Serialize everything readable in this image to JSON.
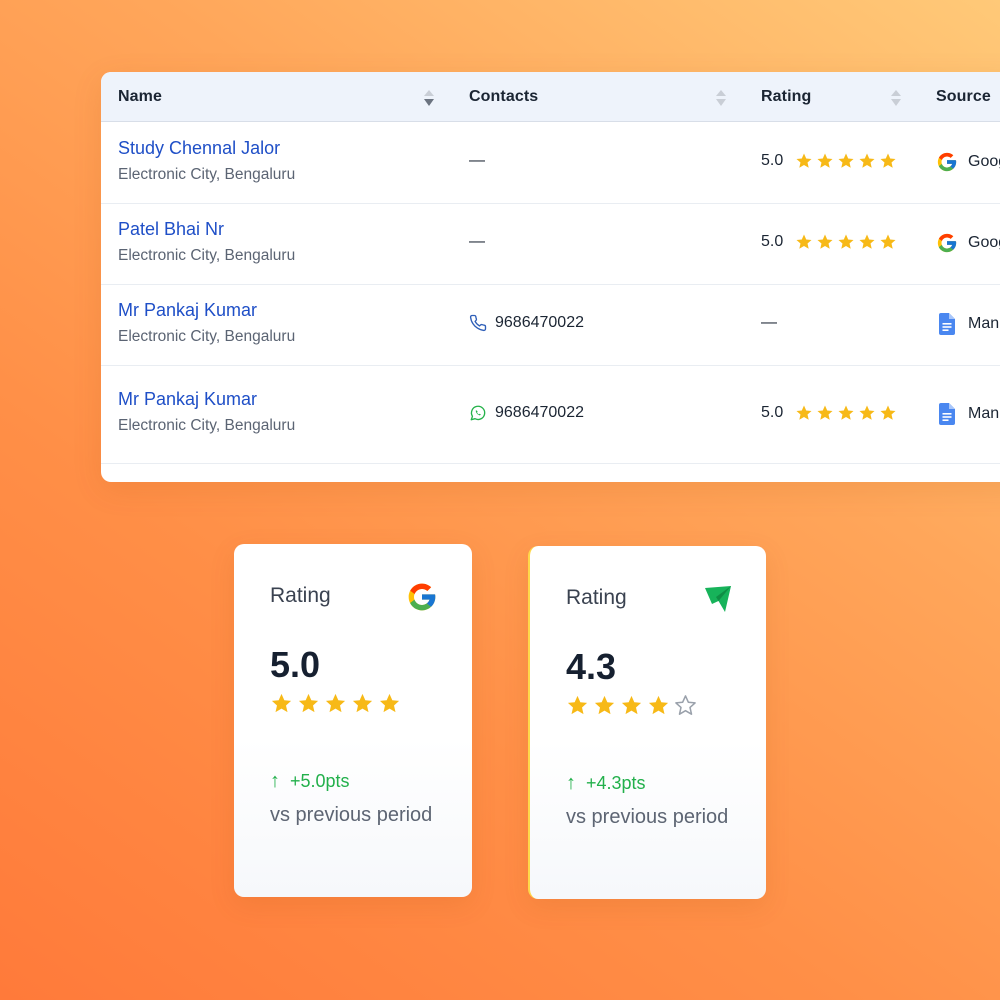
{
  "table": {
    "columns": [
      {
        "key": "name",
        "label": "Name"
      },
      {
        "key": "contacts",
        "label": "Contacts"
      },
      {
        "key": "rating",
        "label": "Rating"
      },
      {
        "key": "source",
        "label": "Source"
      }
    ],
    "rows": [
      {
        "name": "Study Chennal Jalor",
        "location": "Electronic City, Bengaluru",
        "contact": "—",
        "contact_icon": "",
        "rating": "5.0",
        "stars": 5,
        "source": "Goog",
        "source_icon": "google-icon"
      },
      {
        "name": "Patel Bhai Nr",
        "location": "Electronic City, Bengaluru",
        "contact": "—",
        "contact_icon": "",
        "rating": "5.0",
        "stars": 5,
        "source": "Goog",
        "source_icon": "google-icon"
      },
      {
        "name": "Mr Pankaj Kumar",
        "location": "Electronic City, Bengaluru",
        "contact": "9686470022",
        "contact_icon": "phone-icon",
        "rating": "—",
        "stars": 0,
        "source": "Man",
        "source_icon": "document-icon"
      },
      {
        "name": "Mr Pankaj Kumar",
        "location": "Electronic City, Bengaluru",
        "contact": "9686470022",
        "contact_icon": "whatsapp-icon",
        "rating": "5.0",
        "stars": 5,
        "source": "Man",
        "source_icon": "document-icon"
      }
    ]
  },
  "cards": [
    {
      "label": "Rating",
      "logo": "google-icon",
      "value": "5.0",
      "stars": 5,
      "change": "+5.0pts",
      "compare": "vs previous period"
    },
    {
      "label": "Rating",
      "logo": "send-arrow-icon",
      "value": "4.3",
      "stars": 4,
      "change": "+4.3pts",
      "compare": "vs previous period"
    }
  ],
  "colors": {
    "link": "#1f4fc7",
    "star": "#f7b917",
    "positive": "#22b04b",
    "header_bg": "#eef3fb"
  }
}
